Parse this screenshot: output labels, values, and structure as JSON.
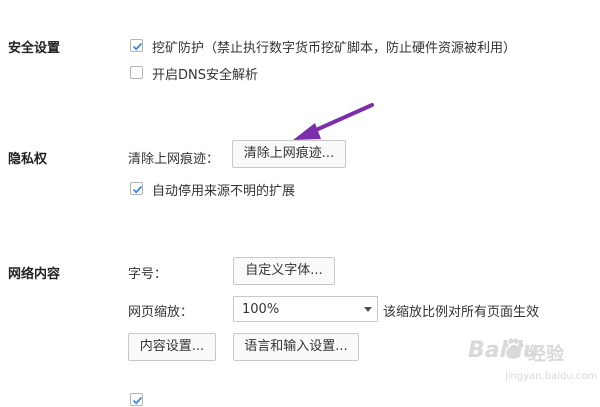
{
  "security": {
    "title": "安全设置",
    "mining_protection_label": "挖矿防护（禁止执行数字货币挖矿脚本，防止硬件资源被利用）",
    "mining_protection_checked": true,
    "dns_label": "开启DNS安全解析",
    "dns_checked": false
  },
  "privacy": {
    "title": "隐私权",
    "clear_traces_label": "清除上网痕迹：",
    "clear_traces_button": "清除上网痕迹...",
    "auto_disable_label": "自动停用来源不明的扩展",
    "auto_disable_checked": true
  },
  "web_content": {
    "title": "网络内容",
    "font_label": "字号：",
    "font_button": "自定义字体...",
    "zoom_label": "网页缩放：",
    "zoom_value": "100%",
    "zoom_note": "该缩放比例对所有页面生效",
    "content_settings_button": "内容设置...",
    "language_button": "语言和输入设置..."
  },
  "watermark": {
    "brand": "Baidu",
    "suffix": "经验",
    "url": "jingyan.baidu.com"
  },
  "colors": {
    "arrow": "#7b2fa8",
    "checkmark": "#3a8be0"
  }
}
